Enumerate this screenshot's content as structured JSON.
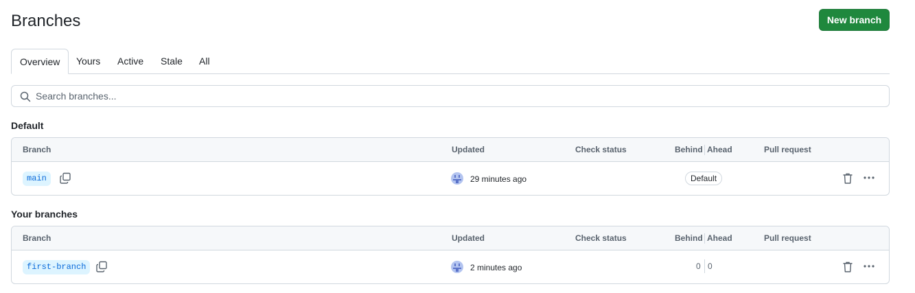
{
  "page": {
    "title": "Branches",
    "new_branch_label": "New branch"
  },
  "tabs": [
    {
      "label": "Overview",
      "selected": true
    },
    {
      "label": "Yours",
      "selected": false
    },
    {
      "label": "Active",
      "selected": false
    },
    {
      "label": "Stale",
      "selected": false
    },
    {
      "label": "All",
      "selected": false
    }
  ],
  "search": {
    "placeholder": "Search branches..."
  },
  "columns": {
    "branch": "Branch",
    "updated": "Updated",
    "check_status": "Check status",
    "behind": "Behind",
    "ahead": "Ahead",
    "pull_request": "Pull request"
  },
  "sections": [
    {
      "title": "Default",
      "rows": [
        {
          "branch": "main",
          "updated": "29 minutes ago",
          "badge": "Default"
        }
      ]
    },
    {
      "title": "Your branches",
      "rows": [
        {
          "branch": "first-branch",
          "updated": "2 minutes ago",
          "behind": "0",
          "ahead": "0"
        }
      ]
    }
  ],
  "colors": {
    "primary_button": "#1f883d",
    "branch_pill_bg": "#ddf4ff",
    "branch_pill_text": "#0969da",
    "border": "#d0d7de"
  },
  "icons": [
    "search-icon",
    "copy-icon",
    "avatar",
    "trash-icon",
    "kebab-icon"
  ]
}
